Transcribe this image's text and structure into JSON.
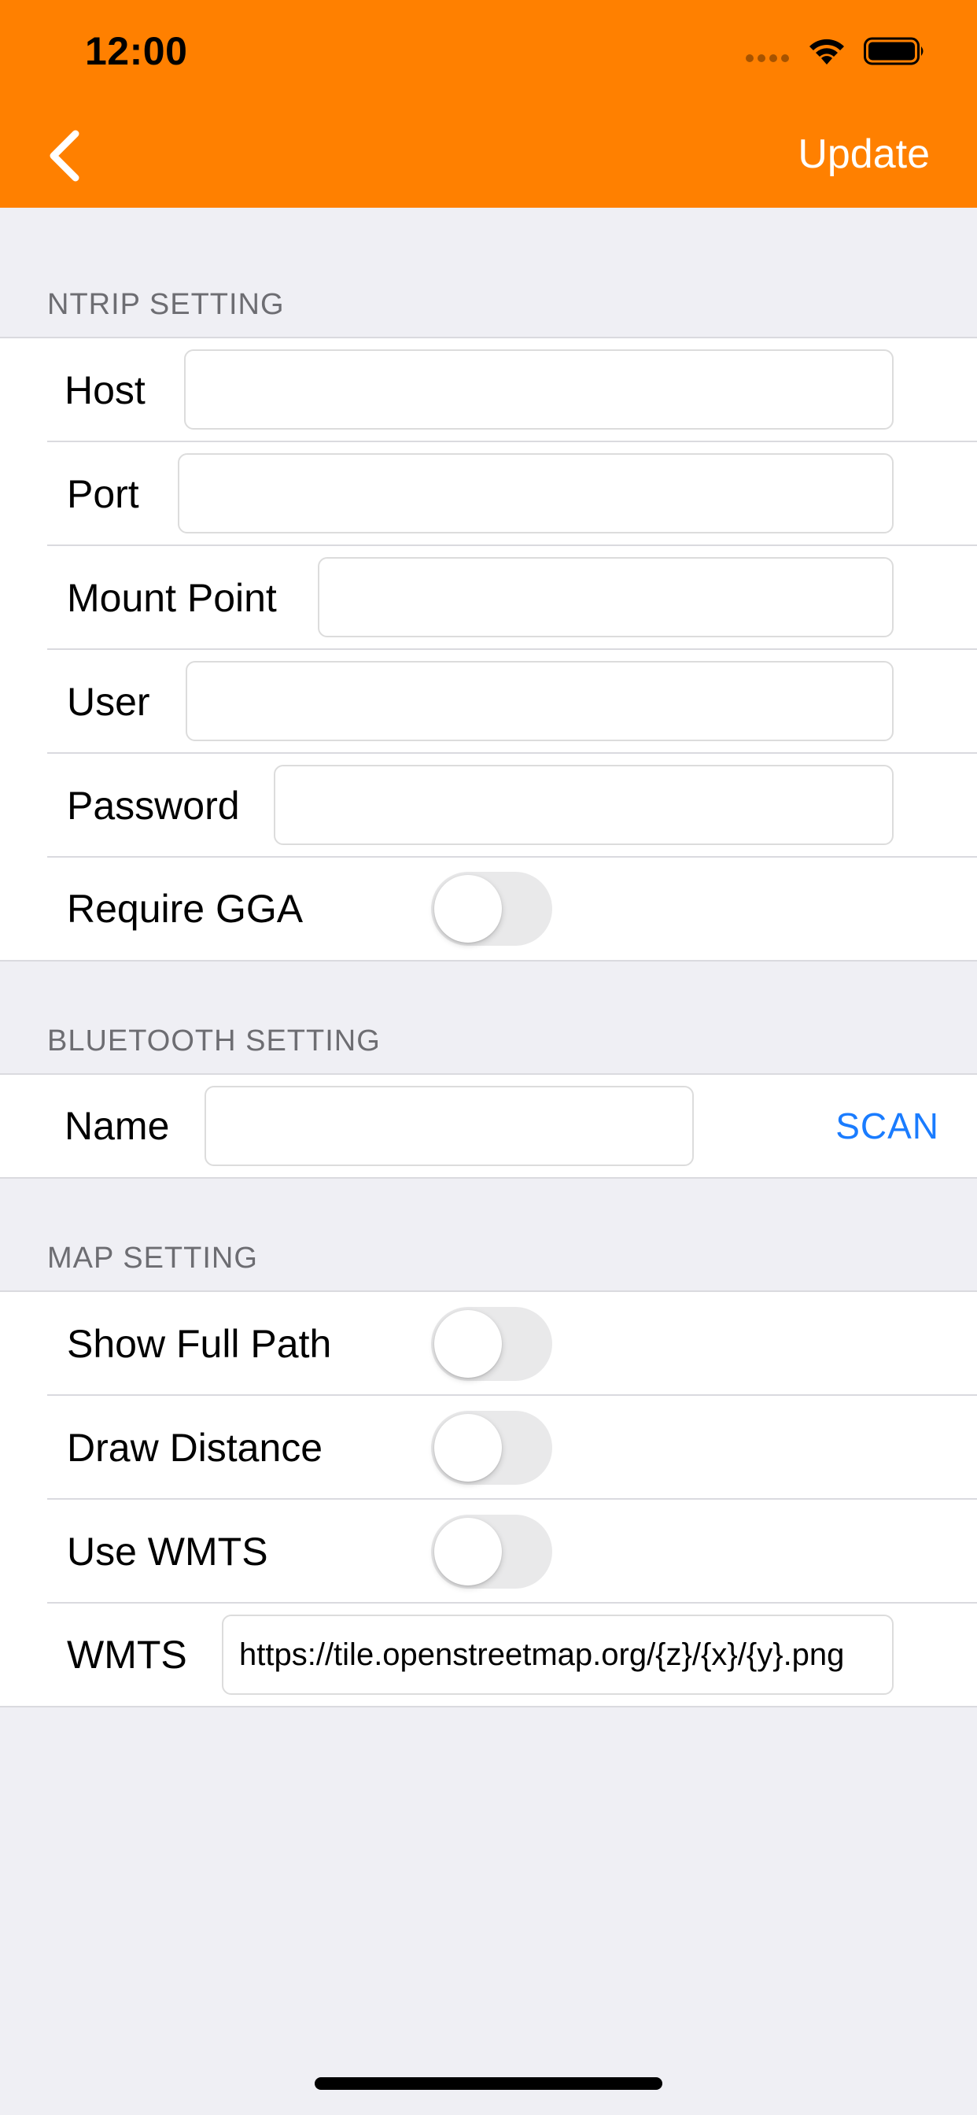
{
  "status_bar": {
    "time": "12:00"
  },
  "nav": {
    "update_label": "Update"
  },
  "ntrip": {
    "header": "NTRIP SETTING",
    "host_label": "Host",
    "host_value": "",
    "port_label": "Port",
    "port_value": "",
    "mount_label": "Mount Point",
    "mount_value": "",
    "user_label": "User",
    "user_value": "",
    "password_label": "Password",
    "password_value": "",
    "gga_label": "Require GGA",
    "gga_on": false
  },
  "bluetooth": {
    "header": "BLUETOOTH SETTING",
    "name_label": "Name",
    "name_value": "",
    "scan_label": "SCAN"
  },
  "map": {
    "header": "MAP SETTING",
    "full_path_label": "Show Full Path",
    "full_path_on": false,
    "draw_distance_label": "Draw Distance",
    "draw_distance_on": false,
    "use_wmts_label": "Use WMTS",
    "use_wmts_on": false,
    "wmts_label": "WMTS",
    "wmts_value": "https://tile.openstreetmap.org/{z}/{x}/{y}.png"
  },
  "colors": {
    "accent": "#ff8000",
    "link": "#1a7cff",
    "background": "#efeff4"
  }
}
